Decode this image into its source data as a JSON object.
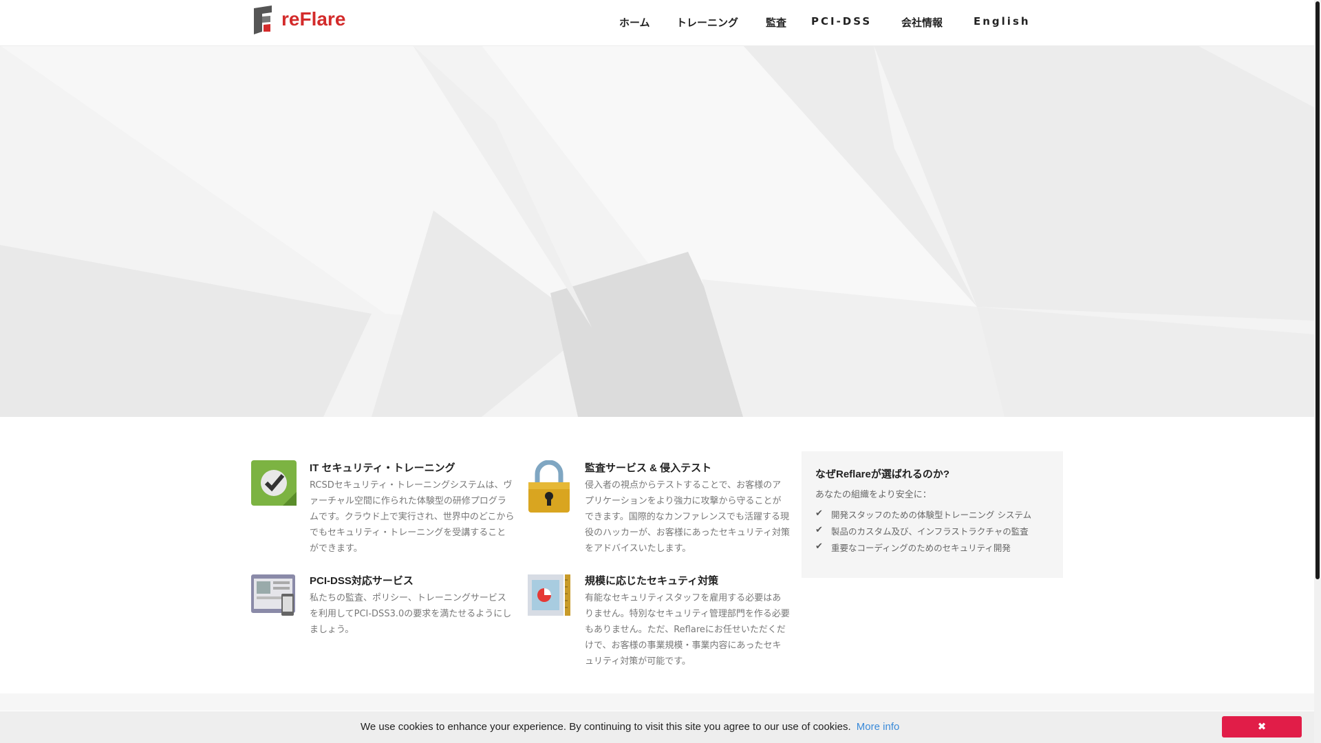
{
  "brand": {
    "logo_text": "reFlare",
    "logo_letter": "F"
  },
  "nav": {
    "items": [
      {
        "label": "ホーム"
      },
      {
        "label": "トレーニング"
      },
      {
        "label": "監査"
      },
      {
        "label": "PCI-DSS"
      },
      {
        "label": "会社情報"
      },
      {
        "label": "English"
      }
    ]
  },
  "features": [
    {
      "icon": "checkmark-icon",
      "title": "IT セキュリティ・トレーニング",
      "desc": "RCSDセキュリティ・トレーニングシステムは、ヴァーチャル空間に作られた体験型の研修プログラムです。クラウド上で実行され、世界中のどこからでもセキュリティ・トレーニングを受講することができます。"
    },
    {
      "icon": "padlock-icon",
      "title": "監査サービス & 侵入テスト",
      "desc": "侵入者の視点からテストすることで、お客様のアプリケーションをより強力に攻撃から守ることができます。国際的なカンファレンスでも活躍する現役のハッカーが、お客様にあったセキュリティ対策をアドバイスいたします。"
    },
    {
      "icon": "computer-screens-icon",
      "title": "PCI-DSS対応サービス",
      "desc": "私たちの監査、ポリシー、トレーニングサービスを利用してPCI-DSS3.0の要求を満たせるようにしましょう。"
    },
    {
      "icon": "chart-document-icon",
      "title": "規模に応じたセキュティ対策",
      "desc": "有能なセキュリティスタッフを雇用する必要はありません。特別なセキュリティ管理部門を作る必要もありません。ただ、Reflareにお任せいただくだけで、お客様の事業規模・事業内容にあったセキュリティ対策が可能です。"
    }
  ],
  "why": {
    "title": "なぜReflareが選ばれるのか?",
    "subtitle": "あなたの組織をより安全に：",
    "items": [
      "開発スタッフのための体験型トレーニング システム",
      "製品のカスタム及び、インフラストラクチャの監査",
      "重要なコーディングのためのセキュリティ開発"
    ]
  },
  "cookie": {
    "text": "We use cookies to enhance your experience. By continuing to visit this site you agree to our use of cookies.",
    "more_info": "More info",
    "close_icon": "✖"
  },
  "colors": {
    "brand_red": "#d32b2b",
    "link_blue": "#3a8ad9",
    "close_button": "#e11d48"
  }
}
